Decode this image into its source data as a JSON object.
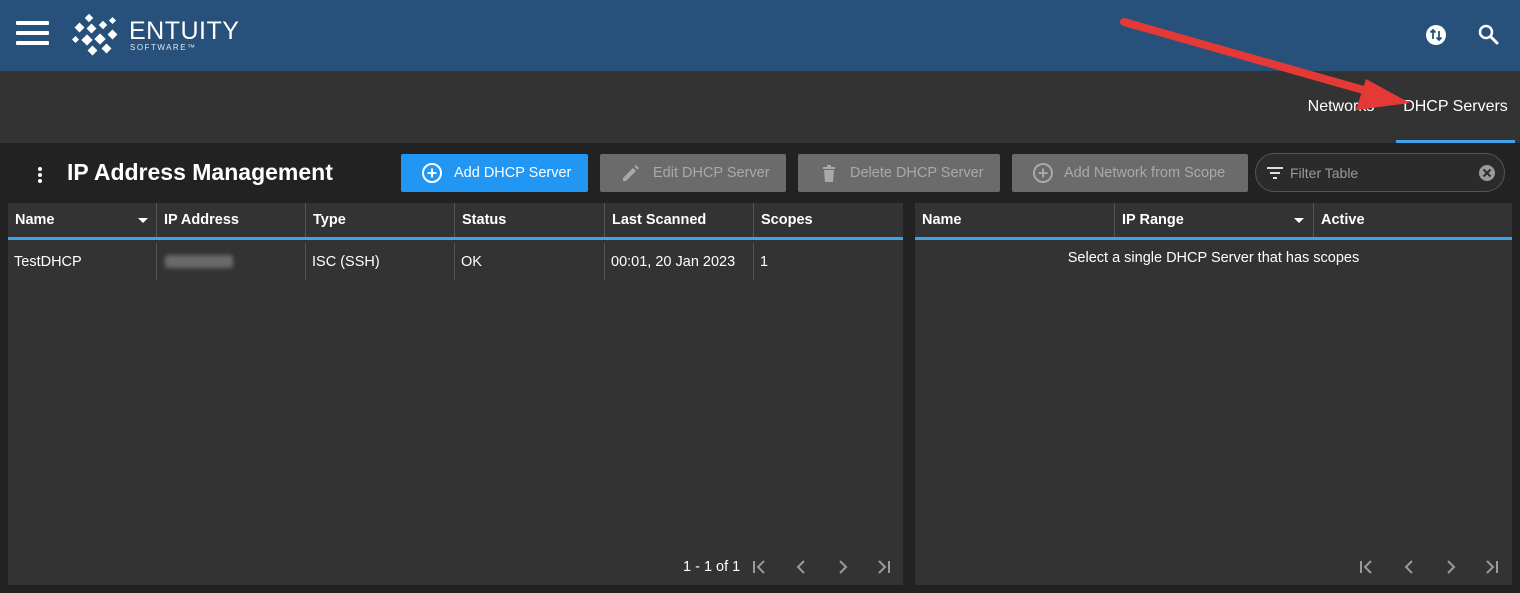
{
  "header": {
    "brand_name": "ENTUITY",
    "brand_sub": "SOFTWARE™",
    "icons": [
      "menu-icon",
      "sync-icon",
      "search-icon"
    ]
  },
  "tabs": [
    {
      "label": "Networks",
      "active": false
    },
    {
      "label": "DHCP Servers",
      "active": true
    }
  ],
  "toolbar": {
    "title": "IP Address Management",
    "add_label": "Add DHCP Server",
    "edit_label": "Edit DHCP Server",
    "delete_label": "Delete DHCP Server",
    "add_network_label": "Add Network from Scope",
    "filter_placeholder": "Filter Table"
  },
  "servers_table": {
    "columns": [
      "Name",
      "IP Address",
      "Type",
      "Status",
      "Last Scanned",
      "Scopes"
    ],
    "rows": [
      {
        "name": "TestDHCP",
        "ip": "",
        "type": "ISC (SSH)",
        "status": "OK",
        "last_scanned": "00:01, 20 Jan 2023",
        "scopes": "1"
      }
    ],
    "pager": "1 - 1 of 1"
  },
  "scopes_table": {
    "columns": [
      "Name",
      "IP Range",
      "Active"
    ],
    "empty_message": "Select a single DHCP Server that has scopes"
  },
  "colors": {
    "header_bg": "#27507a",
    "accent": "#3fa2ea",
    "primary_button": "#2196f3",
    "annotation_arrow": "#e53935"
  }
}
